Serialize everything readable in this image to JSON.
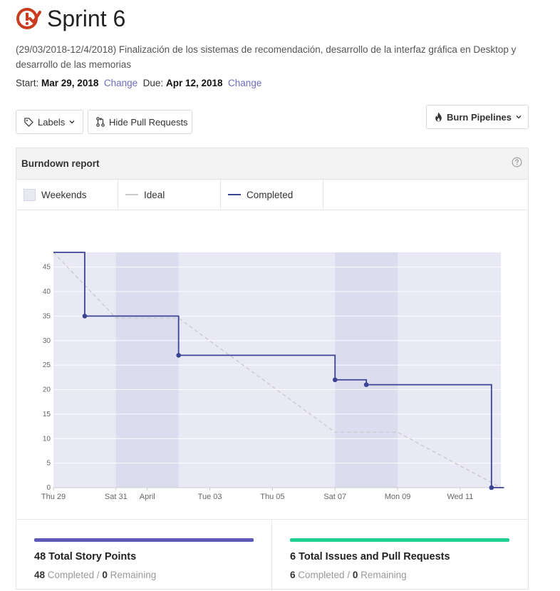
{
  "page": {
    "title": "Sprint 6",
    "description": "(29/03/2018-12/4/2018) Finalización de los sistemas de recomendación, desarrollo de la interfaz gráfica en Desktop y desarrollo de las memorias",
    "start_label": "Start:",
    "start_date": "Mar 29, 2018",
    "due_label": "Due:",
    "due_date": "Apr 12, 2018",
    "change_label": "Change"
  },
  "toolbar": {
    "labels_button": "Labels",
    "hide_pr_button": "Hide Pull Requests",
    "burn_pipelines_button": "Burn Pipelines"
  },
  "report": {
    "title": "Burndown report",
    "legend": {
      "weekends": "Weekends",
      "ideal": "Ideal",
      "completed": "Completed"
    }
  },
  "colors": {
    "completed_line": "#3b4394",
    "ideal_line": "#cccccc",
    "weekend_fill": "#dcdcef",
    "plot_fill": "#e9e9f6",
    "points_bar": "#5b58b8",
    "issues_bar": "#1ecf8f",
    "brand": "#c93c1f"
  },
  "chart_data": {
    "type": "line",
    "x_tick_labels": [
      "Thu 29",
      "Sat 31",
      "April",
      "Tue 03",
      "Thu 05",
      "Sat 07",
      "Mon 09",
      "Wed 11"
    ],
    "x_tick_days": [
      0,
      2,
      3,
      5,
      7,
      9,
      11,
      13
    ],
    "x_range_days": [
      0,
      14.3
    ],
    "ylim": [
      0,
      48
    ],
    "y_ticks": [
      0,
      5,
      10,
      15,
      20,
      25,
      30,
      35,
      40,
      45
    ],
    "weekends": [
      [
        2,
        4
      ],
      [
        9,
        11
      ]
    ],
    "series": [
      {
        "name": "Completed",
        "step": true,
        "points": [
          [
            0,
            48
          ],
          [
            1,
            35
          ],
          [
            4,
            27
          ],
          [
            9,
            22
          ],
          [
            10,
            21
          ],
          [
            14,
            0
          ],
          [
            14.4,
            0
          ]
        ],
        "markers": [
          [
            1,
            35
          ],
          [
            4,
            27
          ],
          [
            9,
            22
          ],
          [
            10,
            21
          ],
          [
            14,
            0
          ]
        ]
      },
      {
        "name": "Ideal",
        "dashed": true,
        "points": [
          [
            0,
            48
          ],
          [
            2,
            34.6
          ],
          [
            4,
            34.6
          ],
          [
            9,
            11.3
          ],
          [
            11,
            11.3
          ],
          [
            14.3,
            0
          ]
        ]
      }
    ]
  },
  "stats": {
    "points": {
      "title": "48 Total Story Points",
      "completed": "48",
      "completed_label": "Completed",
      "sep": "/",
      "remaining": "0",
      "remaining_label": "Remaining"
    },
    "issues": {
      "title": "6 Total Issues and Pull Requests",
      "completed": "6",
      "completed_label": "Completed",
      "sep": "/",
      "remaining": "0",
      "remaining_label": "Remaining"
    }
  },
  "icons": {
    "title_logo": "milestone-clock-icon",
    "labels": "tag-icon",
    "hide_pr": "pull-request-icon",
    "burn": "flame-icon",
    "help": "question-circle-icon"
  }
}
